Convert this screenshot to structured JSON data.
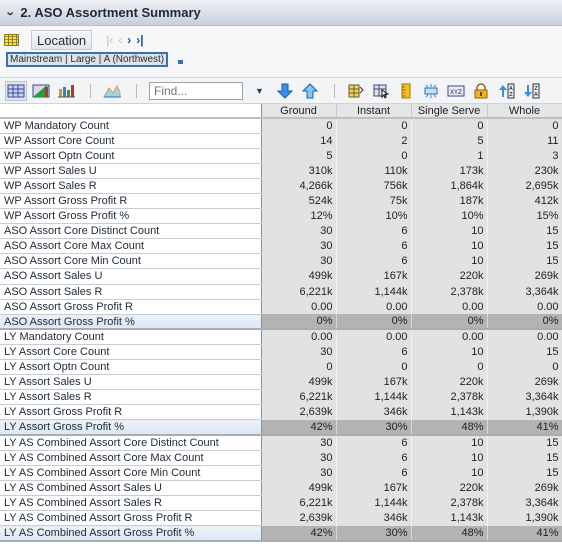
{
  "header": {
    "title": "2. ASO Assortment Summary",
    "collapse_icon": "chevron-down-icon"
  },
  "pivot": {
    "dimension_button": "Location",
    "nav": [
      "first-icon",
      "prev-icon",
      "next-icon",
      "last-icon"
    ],
    "selected_member": "Mainstream | Large | A (Northwest)"
  },
  "toolbar": {
    "find_placeholder": "Find...",
    "icons": [
      "grid-view-icon",
      "grid-chart-view-icon",
      "chart-view-icon",
      "area-chart-icon",
      "find-dropdown-icon",
      "find-next-icon",
      "find-previous-icon",
      "show-hide-columns-icon",
      "select-icon",
      "ruler-icon",
      "break-icon",
      "xyz-icon",
      "lock-icon",
      "sort-ascending-icon",
      "sort-descending-icon"
    ]
  },
  "table": {
    "columns": [
      "Ground",
      "Instant",
      "Single Serve",
      "Whole"
    ],
    "rows": [
      {
        "label": "WP Mandatory Count",
        "values": [
          "0",
          "0",
          "0",
          "0"
        ]
      },
      {
        "label": "WP Assort Core Count",
        "values": [
          "14",
          "2",
          "5",
          "11"
        ]
      },
      {
        "label": "WP Assort Optn Count",
        "values": [
          "5",
          "0",
          "1",
          "3"
        ]
      },
      {
        "label": "WP Assort Sales U",
        "values": [
          "310k",
          "110k",
          "173k",
          "230k"
        ]
      },
      {
        "label": "WP Assort Sales R",
        "values": [
          "4,266k",
          "756k",
          "1,864k",
          "2,695k"
        ]
      },
      {
        "label": "WP Assort Gross Profit R",
        "values": [
          "524k",
          "75k",
          "187k",
          "412k"
        ]
      },
      {
        "label": "WP Assort Gross Profit %",
        "values": [
          "12%",
          "10%",
          "10%",
          "15%"
        ]
      },
      {
        "label": "ASO Assort Core Distinct Count",
        "values": [
          "30",
          "6",
          "10",
          "15"
        ]
      },
      {
        "label": "ASO Assort Core Max Count",
        "values": [
          "30",
          "6",
          "10",
          "15"
        ]
      },
      {
        "label": "ASO Assort Core Min Count",
        "values": [
          "30",
          "6",
          "10",
          "15"
        ]
      },
      {
        "label": "ASO Assort Sales U",
        "values": [
          "499k",
          "167k",
          "220k",
          "269k"
        ]
      },
      {
        "label": "ASO Assort Sales R",
        "values": [
          "6,221k",
          "1,144k",
          "2,378k",
          "3,364k"
        ]
      },
      {
        "label": "ASO Assort Gross Profit R",
        "values": [
          "0.00",
          "0.00",
          "0.00",
          "0.00"
        ]
      },
      {
        "label": "ASO Assort Gross Profit %",
        "values": [
          "0%",
          "0%",
          "0%",
          "0%"
        ],
        "highlight": true
      },
      {
        "label": "LY Mandatory Count",
        "values": [
          "0.00",
          "0.00",
          "0.00",
          "0.00"
        ]
      },
      {
        "label": "LY Assort Core Count",
        "values": [
          "30",
          "6",
          "10",
          "15"
        ]
      },
      {
        "label": "LY Assort Optn Count",
        "values": [
          "0",
          "0",
          "0",
          "0"
        ]
      },
      {
        "label": "LY Assort Sales U",
        "values": [
          "499k",
          "167k",
          "220k",
          "269k"
        ]
      },
      {
        "label": "LY Assort Sales R",
        "values": [
          "6,221k",
          "1,144k",
          "2,378k",
          "3,364k"
        ]
      },
      {
        "label": "LY Assort Gross Profit R",
        "values": [
          "2,639k",
          "346k",
          "1,143k",
          "1,390k"
        ]
      },
      {
        "label": "LY Assort Gross Profit %",
        "values": [
          "42%",
          "30%",
          "48%",
          "41%"
        ],
        "highlight": true
      },
      {
        "label": "LY AS Combined Assort Core Distinct Count",
        "values": [
          "30",
          "6",
          "10",
          "15"
        ]
      },
      {
        "label": "LY AS Combined Assort Core Max Count",
        "values": [
          "30",
          "6",
          "10",
          "15"
        ]
      },
      {
        "label": "LY AS Combined Assort Core Min Count",
        "values": [
          "30",
          "6",
          "10",
          "15"
        ]
      },
      {
        "label": "LY AS Combined Assort Sales U",
        "values": [
          "499k",
          "167k",
          "220k",
          "269k"
        ]
      },
      {
        "label": "LY AS Combined Assort Sales R",
        "values": [
          "6,221k",
          "1,144k",
          "2,378k",
          "3,364k"
        ]
      },
      {
        "label": "LY AS Combined Assort Gross Profit R",
        "values": [
          "2,639k",
          "346k",
          "1,143k",
          "1,390k"
        ]
      },
      {
        "label": "LY AS Combined Assort Gross Profit %",
        "values": [
          "42%",
          "30%",
          "48%",
          "41%"
        ],
        "highlight": true
      }
    ]
  }
}
